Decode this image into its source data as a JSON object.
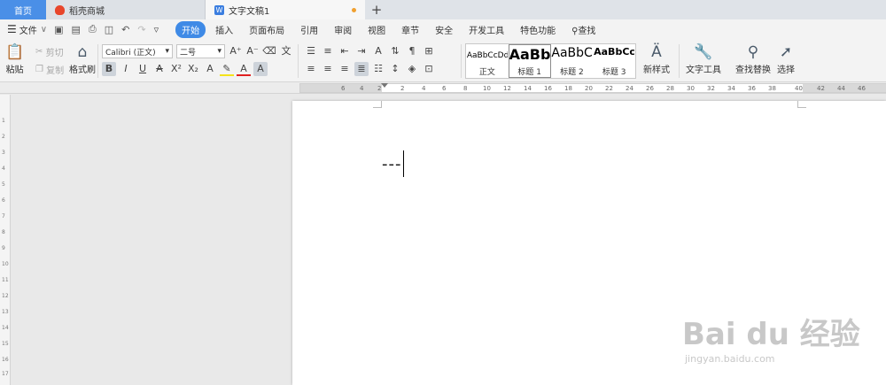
{
  "tabs": {
    "home": "首页",
    "store": "稻壳商城",
    "doc": "文字文稿1",
    "new_tab": "+"
  },
  "menu": {
    "file": "文件",
    "items": [
      "开始",
      "插入",
      "页面布局",
      "引用",
      "审阅",
      "视图",
      "章节",
      "安全",
      "开发工具",
      "特色功能"
    ],
    "search": "查找",
    "active_index": 0
  },
  "ribbon": {
    "paste": "粘贴",
    "cut": "剪切",
    "copy": "复制",
    "format_painter": "格式刷",
    "font_name": "Calibri (正文)",
    "font_size": "二号",
    "styles": [
      {
        "preview": "AaBbCcDd",
        "name": "正文"
      },
      {
        "preview": "AaBb",
        "name": "标题 1"
      },
      {
        "preview": "AaBbC",
        "name": "标题 2"
      },
      {
        "preview": "AaBbCcI",
        "name": "标题 3"
      }
    ],
    "new_style": "新样式",
    "text_tools": "文字工具",
    "find_replace": "查找替换",
    "select": "选择"
  },
  "ruler": {
    "h_numbers": [
      "6",
      "4",
      "2",
      "2",
      "4",
      "6",
      "8",
      "10",
      "12",
      "14",
      "16",
      "18",
      "20",
      "22",
      "24",
      "26",
      "28",
      "30",
      "32",
      "34",
      "36",
      "38",
      "40",
      "42",
      "44",
      "46"
    ],
    "v_numbers": [
      "1",
      "2",
      "3",
      "4",
      "5",
      "6",
      "7",
      "8",
      "9",
      "10",
      "11",
      "12",
      "13",
      "14",
      "15",
      "16",
      "17"
    ]
  },
  "document": {
    "text": "---"
  },
  "watermark": {
    "brand": "Bai du 经验",
    "url": "jingyan.baidu.com"
  },
  "colors": {
    "accent": "#3f8ae6",
    "home_tab": "#4a8fe7"
  }
}
